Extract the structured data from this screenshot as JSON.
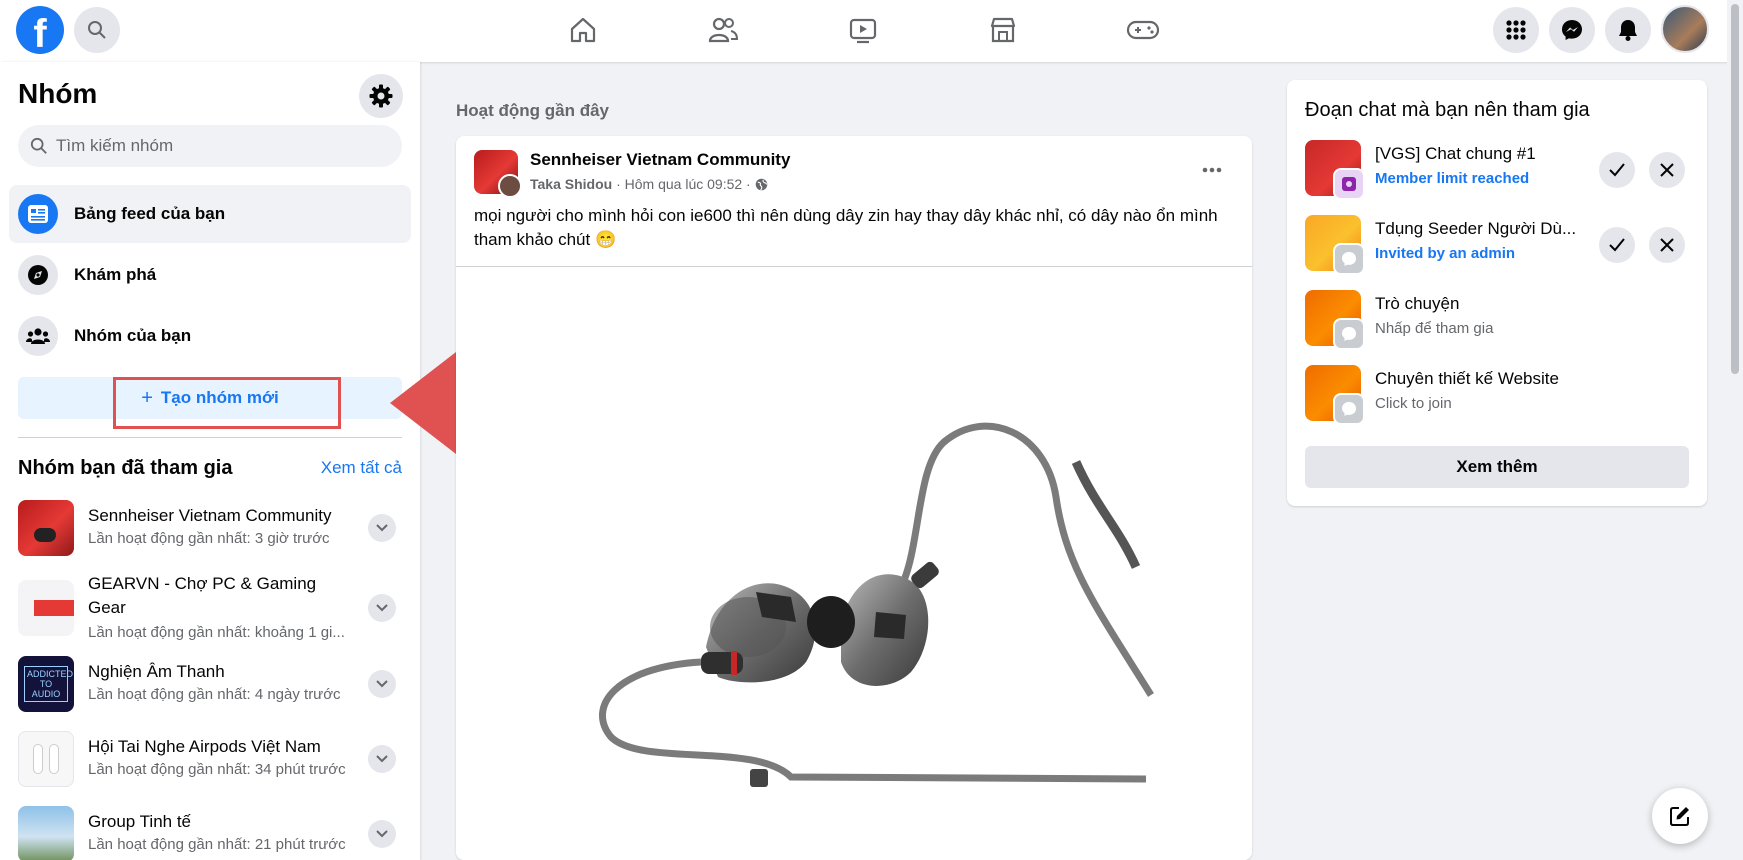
{
  "nav": {
    "logo_letter": "f",
    "icons": [
      "home-icon",
      "friends-icon",
      "watch-icon",
      "marketplace-icon",
      "gaming-icon"
    ],
    "right_icons": [
      "menu-grid-icon",
      "messenger-icon",
      "notifications-icon"
    ]
  },
  "sidebar": {
    "title": "Nhóm",
    "search_placeholder": "Tìm kiếm nhóm",
    "items": [
      {
        "label": "Bảng feed của bạn",
        "icon": "feed-icon"
      },
      {
        "label": "Khám phá",
        "icon": "compass-icon"
      },
      {
        "label": "Nhóm của bạn",
        "icon": "groups-icon"
      }
    ],
    "create_label": "Tạo nhóm mới",
    "joined_title": "Nhóm bạn đã tham gia",
    "see_all": "Xem tất cả",
    "groups": [
      {
        "name": "Sennheiser Vietnam Community",
        "meta": "Lần hoạt động gần nhất: 3 giờ trước"
      },
      {
        "name": "GEARVN - Chợ PC & Gaming Gear",
        "meta": "Lần hoạt động gần nhất: khoảng 1 gi..."
      },
      {
        "name": "Nghiện Âm Thanh",
        "meta": "Lần hoạt động gần nhất: 4 ngày trước",
        "thumb_text": "ADDICTED TO AUDIO"
      },
      {
        "name": "Hội Tai Nghe Airpods Việt Nam",
        "meta": "Lần hoạt động gần nhất: 34 phút trước"
      },
      {
        "name": "Group Tinh tế",
        "meta": "Lần hoạt động gần nhất: 21 phút trước"
      }
    ]
  },
  "feed": {
    "heading": "Hoạt động gần đây",
    "post": {
      "group": "Sennheiser Vietnam Community",
      "author": "Taka Shidou",
      "time": " · Hôm qua lúc 09:52 · ",
      "text": "mọi người cho mình hỏi con ie600 thì nên dùng dây zin hay thay dây khác nhỉ, có dây nào ổn mình tham khảo chút 😁"
    }
  },
  "right": {
    "title": "Đoạn chat mà bạn nên tham gia",
    "chats": [
      {
        "name": "[VGS] Chat chung #1",
        "sub": "Member limit reached"
      },
      {
        "name": "Tdụng Seeder Người Dù...",
        "sub": "Invited by an admin"
      },
      {
        "name": "Trò chuyện",
        "sub": "Nhấp để tham gia"
      },
      {
        "name": "Chuyên thiết kế Website",
        "sub": "Click to join"
      }
    ],
    "see_more": "Xem thêm"
  },
  "colors": {
    "brand": "#1877f2",
    "arrow": "#e05252",
    "highlight_border": "#e05252"
  }
}
